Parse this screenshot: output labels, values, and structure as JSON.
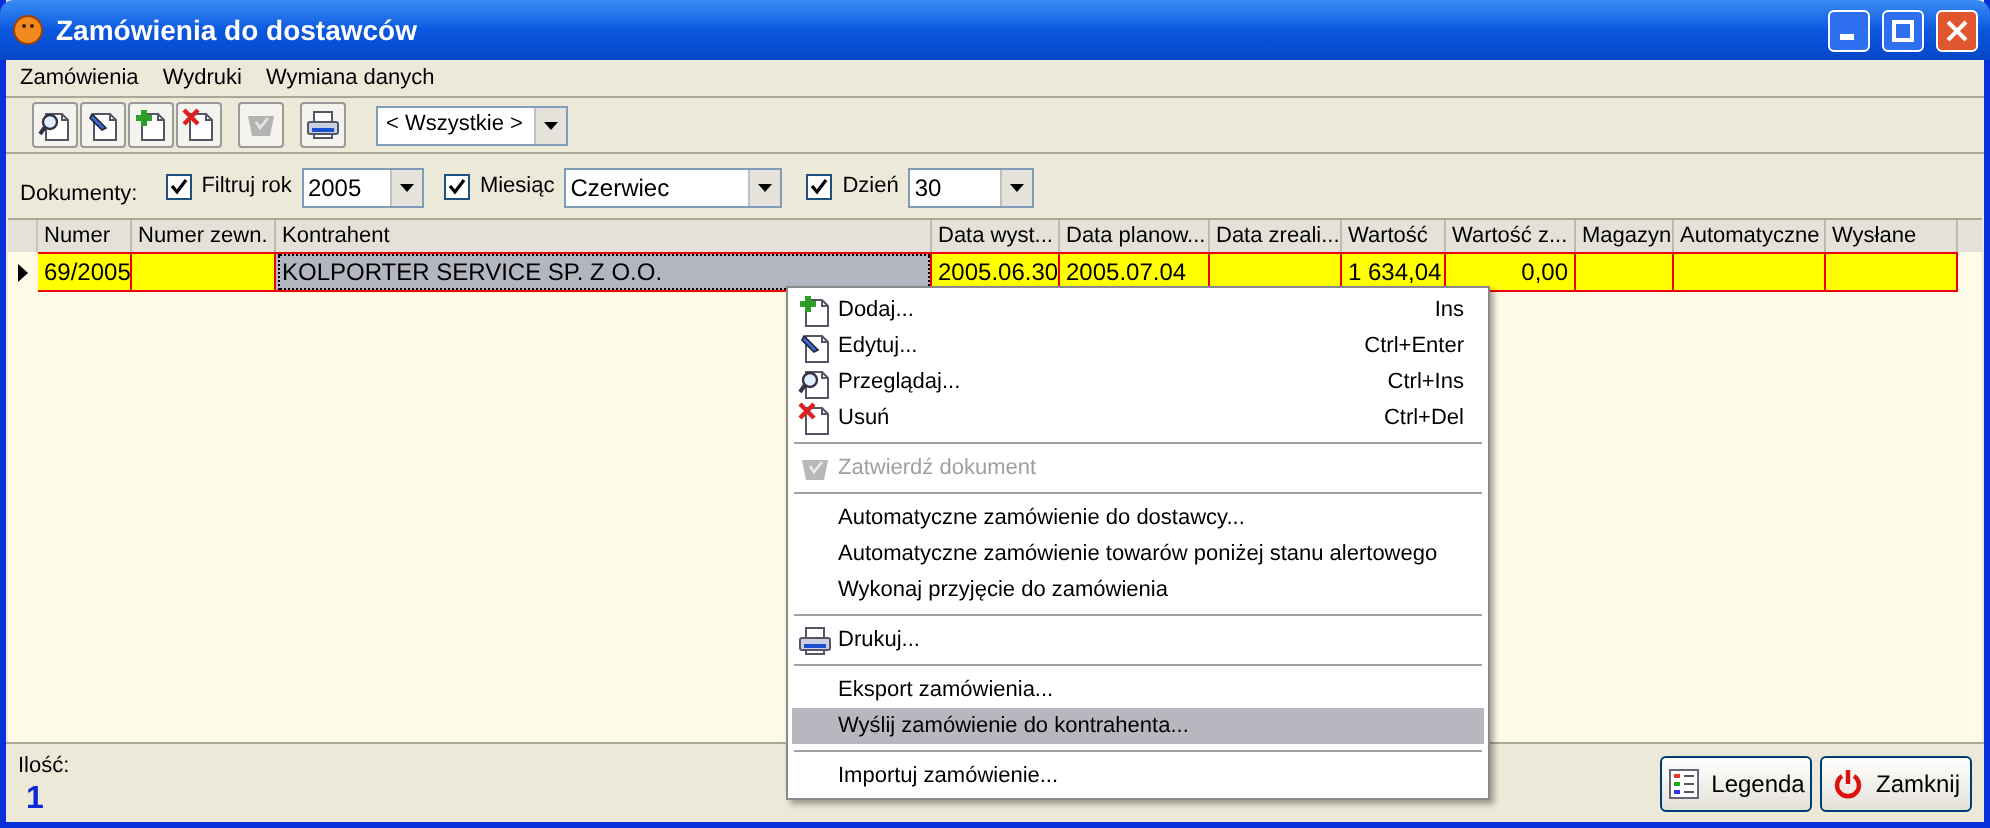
{
  "window": {
    "title": "Zamówienia do dostawców"
  },
  "menu_bar": [
    {
      "label": "Zamówienia"
    },
    {
      "label": "Wydruki"
    },
    {
      "label": "Wymiana danych"
    }
  ],
  "toolbar": {
    "buttons": [
      {
        "kind": "view",
        "disabled": false
      },
      {
        "kind": "edit",
        "disabled": false
      },
      {
        "kind": "add",
        "disabled": false
      },
      {
        "kind": "delete",
        "disabled": false
      },
      {
        "kind": "approve",
        "disabled": true
      },
      {
        "kind": "print",
        "disabled": false
      }
    ],
    "combo": "< Wszystkie >"
  },
  "filters": {
    "label": "Dokumenty:",
    "items": [
      {
        "label": "Filtruj rok",
        "checked": true,
        "value": "2005"
      },
      {
        "label": "Miesiąc",
        "checked": true,
        "value": "Czerwiec"
      },
      {
        "label": "Dzień",
        "checked": true,
        "value": "30"
      }
    ]
  },
  "table": {
    "columns": [
      "Numer",
      "Numer zewn.",
      "Kontrahent",
      "Data wyst...",
      "Data planow...",
      "Data zreali...",
      "Wartość",
      "Wartość z...",
      "Magazyn",
      "Automatyczne",
      "Wysłane"
    ],
    "rows": [
      {
        "selected": true,
        "cells": [
          {
            "text": "69/2005",
            "focused": false
          },
          {
            "focused": false
          },
          {
            "text": "KOLPORTER SERVICE SP. Z O.O.",
            "focused": true
          },
          {
            "text": "2005.06.30",
            "focused": false
          },
          {
            "text": "2005.07.04",
            "focused": false
          },
          {
            "focused": false
          },
          {
            "text": "1 634,04",
            "focused": false
          },
          {
            "text": "0,00",
            "focused": false
          },
          {
            "focused": false
          },
          {
            "focused": false
          },
          {
            "focused": false
          }
        ]
      }
    ]
  },
  "context_menu": [
    {
      "kind": "add",
      "label": "Dodaj...",
      "shortcut": "Ins",
      "disabled": false,
      "selected": false
    },
    {
      "kind": "edit",
      "label": "Edytuj...",
      "shortcut": "Ctrl+Enter",
      "disabled": false,
      "selected": false
    },
    {
      "kind": "view",
      "label": "Przeglądaj...",
      "shortcut": "Ctrl+Ins",
      "disabled": false,
      "selected": false
    },
    {
      "kind": "delete",
      "label": "Usuń",
      "shortcut": "Ctrl+Del",
      "disabled": false,
      "selected": false
    },
    {
      "kind": "separator"
    },
    {
      "kind": "approve",
      "label": "Zatwierdź dokument",
      "disabled": true,
      "selected": false
    },
    {
      "kind": "separator"
    },
    {
      "kind": "item",
      "label": "Automatyczne zamówienie do dostawcy...",
      "disabled": false,
      "selected": false
    },
    {
      "kind": "item",
      "label": "Automatyczne zamówienie towarów poniżej stanu alertowego",
      "disabled": false,
      "selected": false
    },
    {
      "kind": "item",
      "label": "Wykonaj przyjęcie do zamówienia",
      "disabled": false,
      "selected": false
    },
    {
      "kind": "separator"
    },
    {
      "kind": "print",
      "label": "Drukuj...",
      "disabled": false,
      "selected": false
    },
    {
      "kind": "separator"
    },
    {
      "kind": "item",
      "label": "Eksport zamówienia...",
      "disabled": false,
      "selected": false
    },
    {
      "kind": "item",
      "label": "Wyślij zamówienie do kontrahenta...",
      "disabled": false,
      "selected": true
    },
    {
      "kind": "separator"
    },
    {
      "kind": "item",
      "label": "Importuj zamówienie...",
      "disabled": false,
      "selected": false
    }
  ],
  "footer": {
    "count_label": "Ilość:",
    "count": "1",
    "buttons": [
      {
        "kind": "legend",
        "label": "Legenda"
      },
      {
        "kind": "close",
        "label": "Zamknij"
      }
    ]
  }
}
